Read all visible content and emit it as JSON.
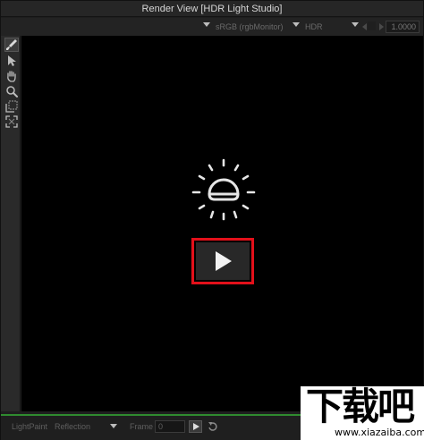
{
  "window": {
    "title": "Render View [HDR Light Studio]"
  },
  "toprow": {
    "colorspace": "sRGB (rgbMonitor)",
    "display_mode": "HDR",
    "exposure": "1.0000"
  },
  "toolbar": {
    "tools": [
      "paint-brush-icon",
      "arrow-pointer-icon",
      "hand-pan-icon",
      "zoom-icon",
      "region-select-icon",
      "fit-view-icon"
    ]
  },
  "viewport": {
    "center_icon": "sun-dome-icon",
    "play_icon": "play-icon"
  },
  "bottom": {
    "mode": "LightPaint",
    "target": "Reflection",
    "frame_label": "Frame",
    "frame_value": "0"
  },
  "watermark": {
    "main": "下载吧",
    "sub": "www.xiazaiba.com"
  },
  "colors": {
    "accent_red": "#e3101a",
    "separator_green": "#2f8b2f",
    "viewport_bg": "#000000"
  }
}
